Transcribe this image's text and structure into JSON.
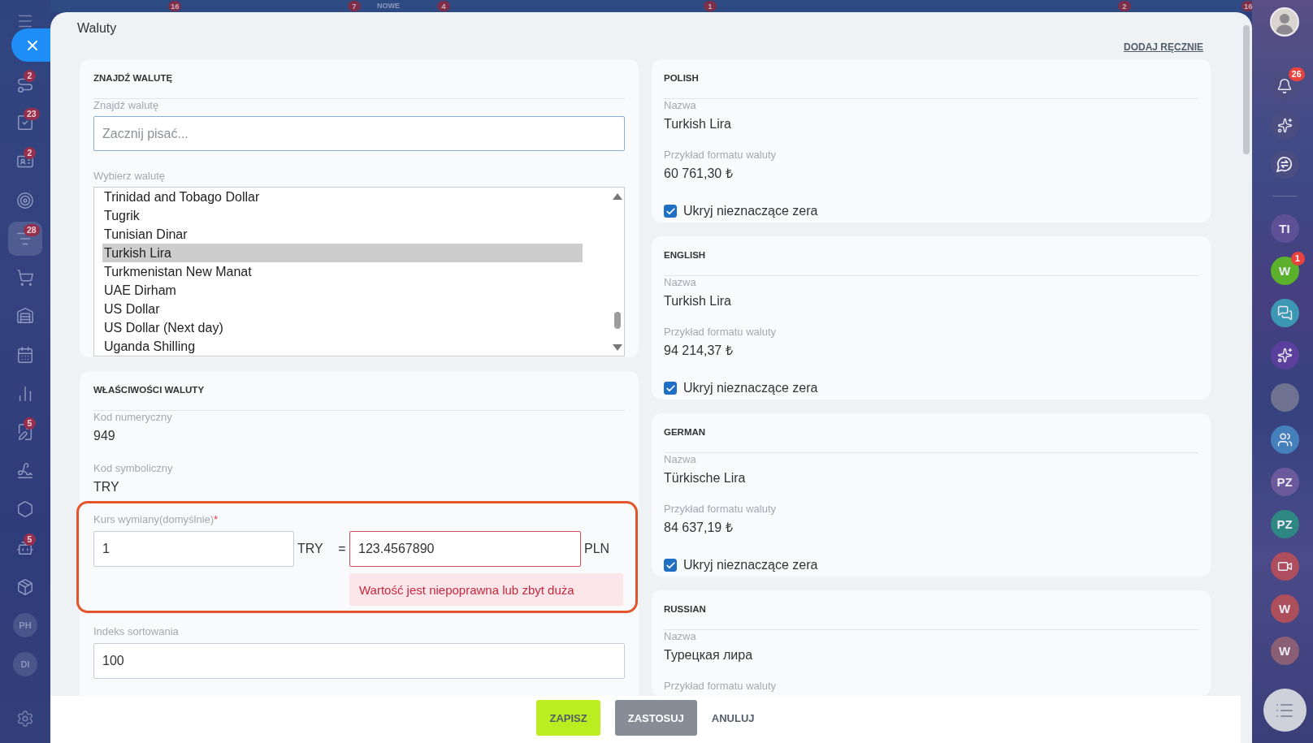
{
  "background_top_bar": {
    "items": [
      {
        "kind": "badge",
        "text": "16"
      },
      {
        "kind": "badge",
        "text": "7"
      },
      {
        "kind": "label",
        "text": "NOWE"
      },
      {
        "kind": "badge",
        "text": "4"
      },
      {
        "kind": "badge",
        "text": "1"
      },
      {
        "kind": "badge",
        "text": "2"
      },
      {
        "kind": "badge",
        "text": "16"
      }
    ]
  },
  "left_sidebar": {
    "items": [
      {
        "selected": false,
        "badge": "2"
      },
      {
        "selected": false,
        "badge": "23"
      },
      {
        "selected": false,
        "badge": "2"
      },
      {
        "selected": false
      },
      {
        "selected": true,
        "badge": "28"
      },
      {
        "selected": false
      },
      {
        "selected": false
      },
      {
        "selected": false
      },
      {
        "selected": false
      },
      {
        "selected": false,
        "badge": "5"
      },
      {
        "selected": false
      },
      {
        "selected": false
      },
      {
        "selected": false,
        "badge": "5"
      },
      {
        "selected": false
      }
    ],
    "users": [
      {
        "initials": "PH"
      },
      {
        "initials": "DI"
      }
    ]
  },
  "panel": {
    "title": "Waluty",
    "add_link": "DODAJ RĘCZNIE",
    "find_currency": {
      "title": "ZNAJDŹ WALUTĘ",
      "search": {
        "label": "Znajdź walutę",
        "placeholder": "Zacznij pisać..."
      },
      "list": {
        "label": "Wybierz walutę",
        "options": [
          {
            "text": "Trinidad and Tobago Dollar",
            "selected": false
          },
          {
            "text": "Tugrik",
            "selected": false
          },
          {
            "text": "Tunisian Dinar",
            "selected": false
          },
          {
            "text": "Turkish Lira",
            "selected": true
          },
          {
            "text": "Turkmenistan New Manat",
            "selected": false
          },
          {
            "text": "UAE Dirham",
            "selected": false
          },
          {
            "text": "US Dollar",
            "selected": false
          },
          {
            "text": "US Dollar (Next day)",
            "selected": false
          },
          {
            "text": "Uganda Shilling",
            "selected": false
          }
        ]
      }
    },
    "properties": {
      "title": "WŁAŚCIWOŚCI WALUTY",
      "fields": [
        {
          "label": "Kod numeryczny",
          "value": "949"
        },
        {
          "label": "Kod symboliczny",
          "value": "TRY"
        }
      ],
      "exchange_rate": {
        "label": "Kurs wymiany(domyślnie)",
        "required_mark": "*",
        "highlighted": true,
        "amount": "1",
        "currency": "TRY",
        "equals": "=",
        "rate": "123.4567890",
        "rate_invalid": true,
        "base_currency": "PLN",
        "error": "Wartość jest niepoprawna lub zbyt duża"
      },
      "sort_index": {
        "label": "Indeks sortowania",
        "value": "100"
      }
    },
    "languages": [
      {
        "title": "POLISH",
        "name_label": "Nazwa",
        "name": "Turkish Lira",
        "format_label": "Przykład formatu waluty",
        "format_example": "60 761,30 ₺",
        "hide_zeros": {
          "label": "Ukryj nieznaczące zera",
          "checked": true
        }
      },
      {
        "title": "ENGLISH",
        "name_label": "Nazwa",
        "name": "Turkish Lira",
        "format_label": "Przykład formatu waluty",
        "format_example": "94 214,37 ₺",
        "hide_zeros": {
          "label": "Ukryj nieznaczące zera",
          "checked": true
        }
      },
      {
        "title": "GERMAN",
        "name_label": "Nazwa",
        "name": "Türkische Lira",
        "format_label": "Przykład formatu waluty",
        "format_example": "84 637,19 ₺",
        "hide_zeros": {
          "label": "Ukryj nieznaczące zera",
          "checked": true
        }
      },
      {
        "title": "RUSSIAN",
        "name_label": "Nazwa",
        "name": "Турецкая лира",
        "format_label": "Przykład formatu waluty"
      }
    ],
    "footer": {
      "buttons": [
        {
          "kind": "primary",
          "label": "ZAPISZ"
        },
        {
          "kind": "secondary",
          "label": "ZASTOSUJ"
        },
        {
          "kind": "link",
          "label": "ANULUJ"
        }
      ]
    }
  },
  "right_sidebar": {
    "notification_count": "26",
    "chats": [
      {
        "kind": "initials",
        "text": "TI",
        "color": "#5d5096"
      },
      {
        "kind": "initials",
        "text": "W",
        "color": "#5bb02c",
        "badge": "1"
      },
      {
        "kind": "icon",
        "color": "#3c98b2"
      },
      {
        "kind": "icon",
        "color": "#5a409c"
      },
      {
        "kind": "photo"
      },
      {
        "kind": "icon",
        "color": "#4580bd"
      },
      {
        "kind": "initials",
        "text": "PZ",
        "color": "#6a5a9c"
      },
      {
        "kind": "initials",
        "text": "PZ",
        "color": "#2e8783"
      },
      {
        "kind": "icon",
        "color": "#ad4d5d"
      },
      {
        "kind": "initials",
        "text": "W",
        "color": "#ad4f5b"
      },
      {
        "kind": "initials",
        "text": "W",
        "color": "#8a5e74"
      }
    ]
  }
}
